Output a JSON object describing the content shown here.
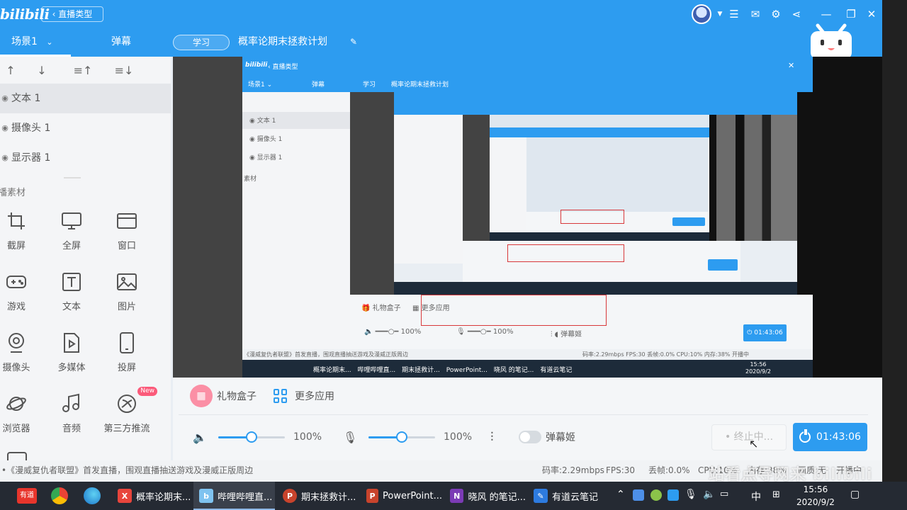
{
  "app": {
    "logo": "bilibili",
    "back_label": "直播类型"
  },
  "header": {
    "scene_tab": "场景1",
    "danmu_tab": "弹幕",
    "category": "学习",
    "stream_title": "概率论期末拯救计划"
  },
  "sidebar": {
    "sources": [
      {
        "label": "文本 1",
        "selected": true
      },
      {
        "label": "摄像头 1"
      },
      {
        "label": "显示器 1"
      }
    ],
    "material_title": "直播素材",
    "tiles": [
      {
        "label": "截屏",
        "icon": "crop-icon"
      },
      {
        "label": "全屏",
        "icon": "monitor-icon"
      },
      {
        "label": "窗口",
        "icon": "window-icon"
      },
      {
        "label": "游戏",
        "icon": "gamepad-icon"
      },
      {
        "label": "文本",
        "icon": "text-icon"
      },
      {
        "label": "图片",
        "icon": "image-icon"
      },
      {
        "label": "摄像头",
        "icon": "webcam-icon"
      },
      {
        "label": "多媒体",
        "icon": "media-icon"
      },
      {
        "label": "投屏",
        "icon": "phone-icon"
      },
      {
        "label": "浏览器",
        "icon": "planet-icon"
      },
      {
        "label": "音频",
        "icon": "music-icon"
      },
      {
        "label": "第三方推流",
        "icon": "stream-icon",
        "badge": "New"
      }
    ]
  },
  "controls": {
    "gift_label": "礼物盒子",
    "more_apps_label": "更多应用",
    "speaker_volume": "100%",
    "speaker_level": 0.5,
    "mic_volume": "100%",
    "mic_level": 0.5,
    "danmaku_toggle_label": "弹幕姬",
    "stop_label": "• 终止中...",
    "timer": "01:43:06"
  },
  "status": {
    "notice": "《漫威复仇者联盟》首发直播，围观直播抽送游戏及漫威正版周边",
    "bitrate": "码率:2.29mbps",
    "fps": "FPS:30",
    "dropped": "丢帧:0.0%",
    "cpu": "CPU:10%",
    "memory": "内存:38%",
    "quality": "画质:无",
    "live_status": "开播中"
  },
  "taskbar": {
    "apps": [
      {
        "label": "概率论期末...",
        "color": "#e8453c",
        "glyph": "X"
      },
      {
        "label": "哔哩哔哩直...",
        "color": "#7fc3f0",
        "glyph": "b",
        "active": true
      },
      {
        "label": "期末拯救计...",
        "color": "#c8432c",
        "glyph": "P"
      },
      {
        "label": "PowerPoint...",
        "color": "#c8432c",
        "glyph": "P"
      },
      {
        "label": "晓风 的笔记...",
        "color": "#7b3bb5",
        "glyph": "N"
      },
      {
        "label": "有道云笔记",
        "color": "#2d7be0",
        "glyph": "✎"
      }
    ],
    "youdao_pin": "有道",
    "ime": "中",
    "time": "15:56",
    "date": "2020/9/2"
  },
  "watermark": "站看点导网来 bilibili",
  "colors": {
    "accent": "#2d9cf0",
    "badge": "#fb5a7a"
  }
}
